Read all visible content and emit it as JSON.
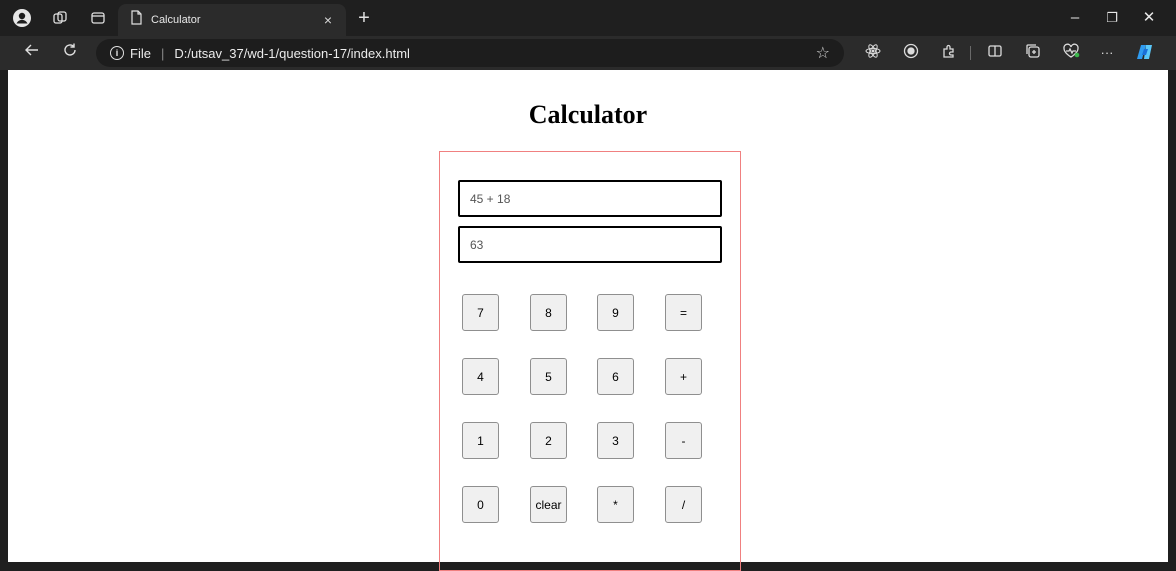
{
  "browser": {
    "tab_title": "Calculator",
    "tab_close": "×",
    "new_tab": "+",
    "window_controls": {
      "minimize": "–",
      "restore": "❐",
      "close": "✕"
    },
    "address": {
      "scheme_label": "File",
      "url": "D:/utsav_37/wd-1/question-17/index.html"
    },
    "more_label": "···"
  },
  "page": {
    "title": "Calculator",
    "expression_value": "45 + 18",
    "result_value": "63"
  },
  "keypad": {
    "row1": [
      "7",
      "8",
      "9",
      "="
    ],
    "row2": [
      "4",
      "5",
      "6",
      "+"
    ],
    "row3": [
      "1",
      "2",
      "3",
      "-"
    ],
    "row4": [
      "0",
      "clear",
      "*",
      "/"
    ]
  },
  "colors": {
    "calc_border": "#f08080",
    "browser_chrome": "#1f1f1f",
    "toolbar": "#2b2b2b"
  }
}
